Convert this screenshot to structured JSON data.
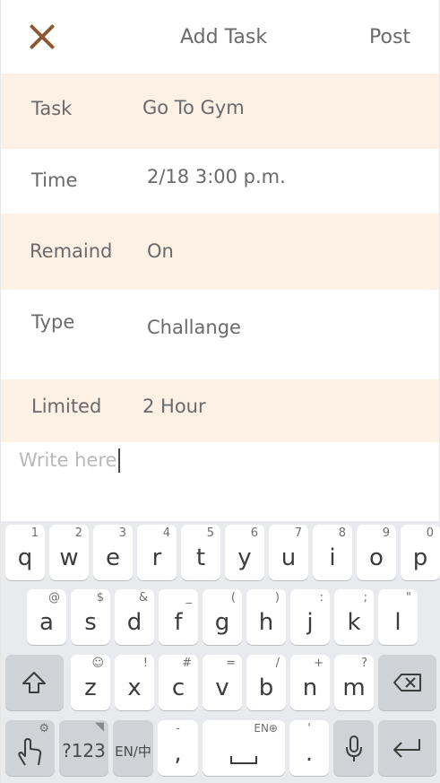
{
  "header": {
    "title": "Add Task",
    "post_label": "Post",
    "close_icon": "close-icon",
    "accent_color": "#8b5a32"
  },
  "form": {
    "task": {
      "label": "Task",
      "value": "Go To Gym"
    },
    "time": {
      "label": "Time",
      "value": "2/18  3:00 p.m."
    },
    "remind": {
      "label": "Remaind",
      "value": "On"
    },
    "type": {
      "label": "Type",
      "value": "Challange"
    },
    "limited": {
      "label": "Limited",
      "value": "2 Hour"
    },
    "row_tint_color": "#fdf1e5"
  },
  "note": {
    "placeholder": "Write here"
  },
  "keyboard": {
    "row1": [
      {
        "key": "q",
        "hint": "1"
      },
      {
        "key": "w",
        "hint": "2"
      },
      {
        "key": "e",
        "hint": "3"
      },
      {
        "key": "r",
        "hint": "4"
      },
      {
        "key": "t",
        "hint": "5"
      },
      {
        "key": "y",
        "hint": "6"
      },
      {
        "key": "u",
        "hint": "7"
      },
      {
        "key": "i",
        "hint": "8"
      },
      {
        "key": "o",
        "hint": "9"
      },
      {
        "key": "p",
        "hint": "0"
      }
    ],
    "row2": [
      {
        "key": "a",
        "hint": "@"
      },
      {
        "key": "s",
        "hint": "$"
      },
      {
        "key": "d",
        "hint": "&"
      },
      {
        "key": "f",
        "hint": "_"
      },
      {
        "key": "g",
        "hint": "("
      },
      {
        "key": "h",
        "hint": ")"
      },
      {
        "key": "j",
        "hint": ":"
      },
      {
        "key": "k",
        "hint": ";"
      },
      {
        "key": "l",
        "hint": "\""
      }
    ],
    "row3": [
      {
        "key": "z",
        "hint": "☺"
      },
      {
        "key": "x",
        "hint": "!"
      },
      {
        "key": "c",
        "hint": "#"
      },
      {
        "key": "v",
        "hint": "="
      },
      {
        "key": "b",
        "hint": "/"
      },
      {
        "key": "n",
        "hint": "+"
      },
      {
        "key": "m",
        "hint": "?"
      }
    ],
    "symbols_label": "?123",
    "lang_label": "EN/中",
    "comma_key": ",",
    "comma_hint": "-",
    "space_hint": "EN⊕",
    "period_key": ".",
    "period_hint": "'",
    "icons": [
      "shift-icon",
      "backspace-icon",
      "gesture-icon",
      "mic-icon",
      "enter-icon",
      "space-bar-icon"
    ]
  }
}
